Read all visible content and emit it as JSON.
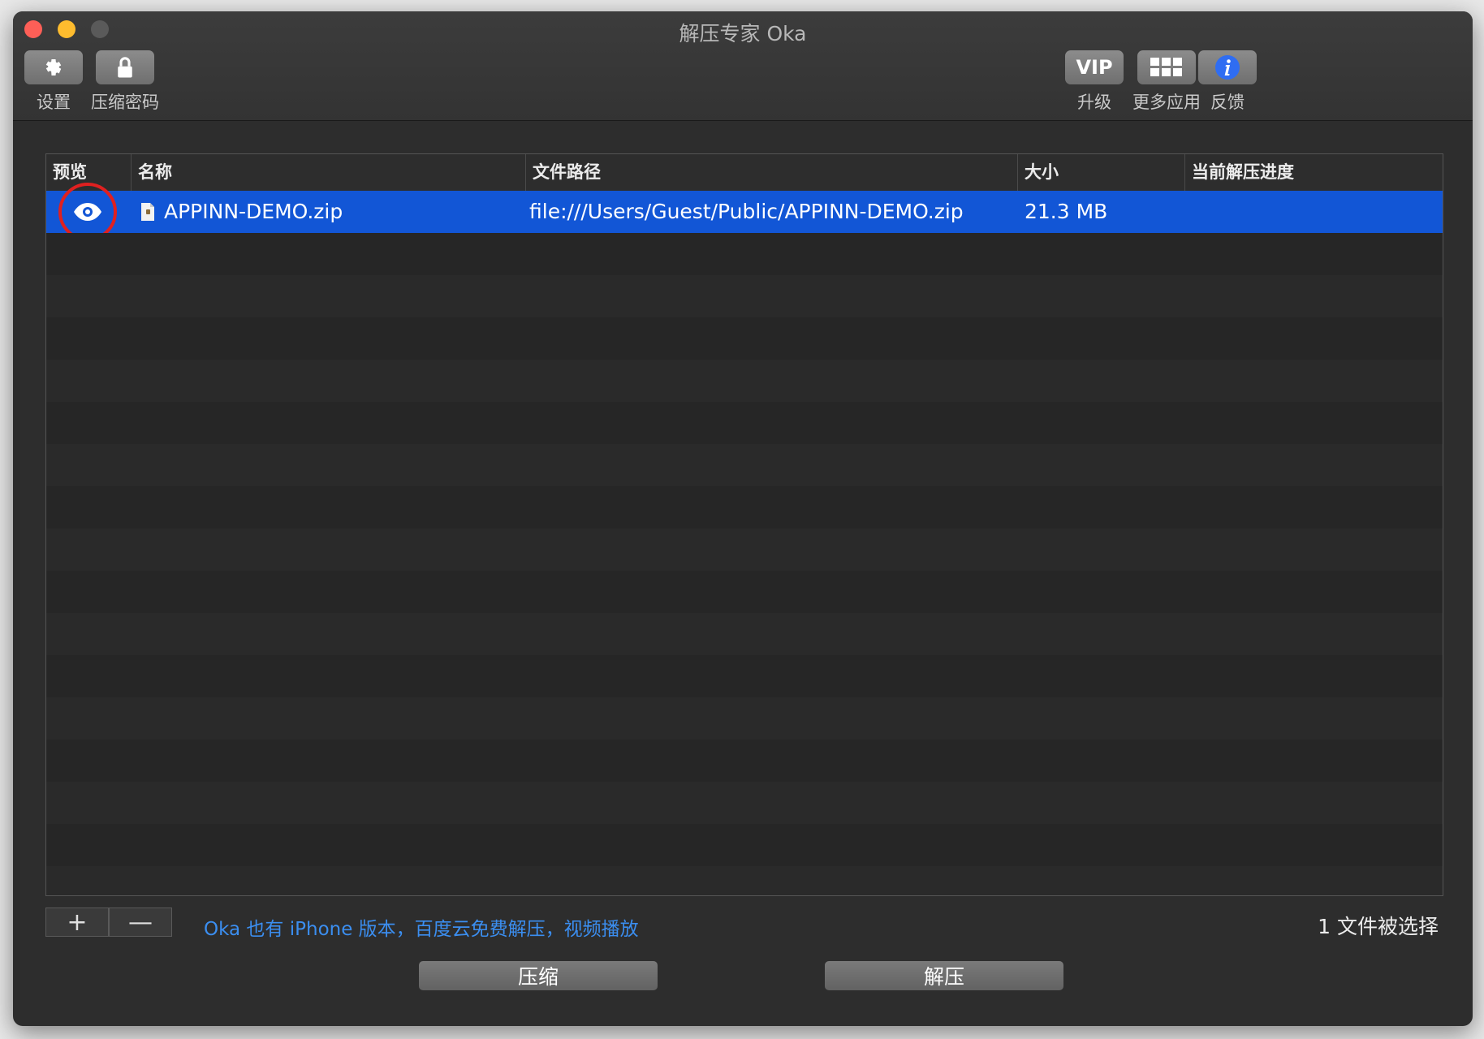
{
  "window": {
    "title": "解压专家 Oka"
  },
  "toolbar": {
    "left": [
      {
        "label": "设置",
        "icon": "gear-icon"
      },
      {
        "label": "压缩密码",
        "icon": "lock-icon"
      }
    ],
    "right": [
      {
        "label": "升级",
        "icon": "vip-icon",
        "badge": "VIP"
      },
      {
        "label": "更多应用",
        "icon": "grid-icon"
      },
      {
        "label": "反馈",
        "icon": "info-icon"
      }
    ]
  },
  "table": {
    "columns": [
      "预览",
      "名称",
      "文件路径",
      "大小",
      "当前解压进度"
    ],
    "rows": [
      {
        "preview_icon": "eye-icon",
        "name": "APPINN-DEMO.zip",
        "path": "file:///Users/Guest/Public/APPINN-DEMO.zip",
        "size": "21.3 MB",
        "progress": ""
      }
    ]
  },
  "footer": {
    "add_label": "+",
    "remove_label": "—",
    "promo_link": "Oka 也有 iPhone 版本，百度云免费解压，视频播放",
    "status": "1 文件被选择"
  },
  "actions": {
    "compress": "压缩",
    "extract": "解压"
  },
  "colors": {
    "selection": "#1256d6",
    "link": "#3b8ef0",
    "highlight_circle": "#e02020"
  }
}
